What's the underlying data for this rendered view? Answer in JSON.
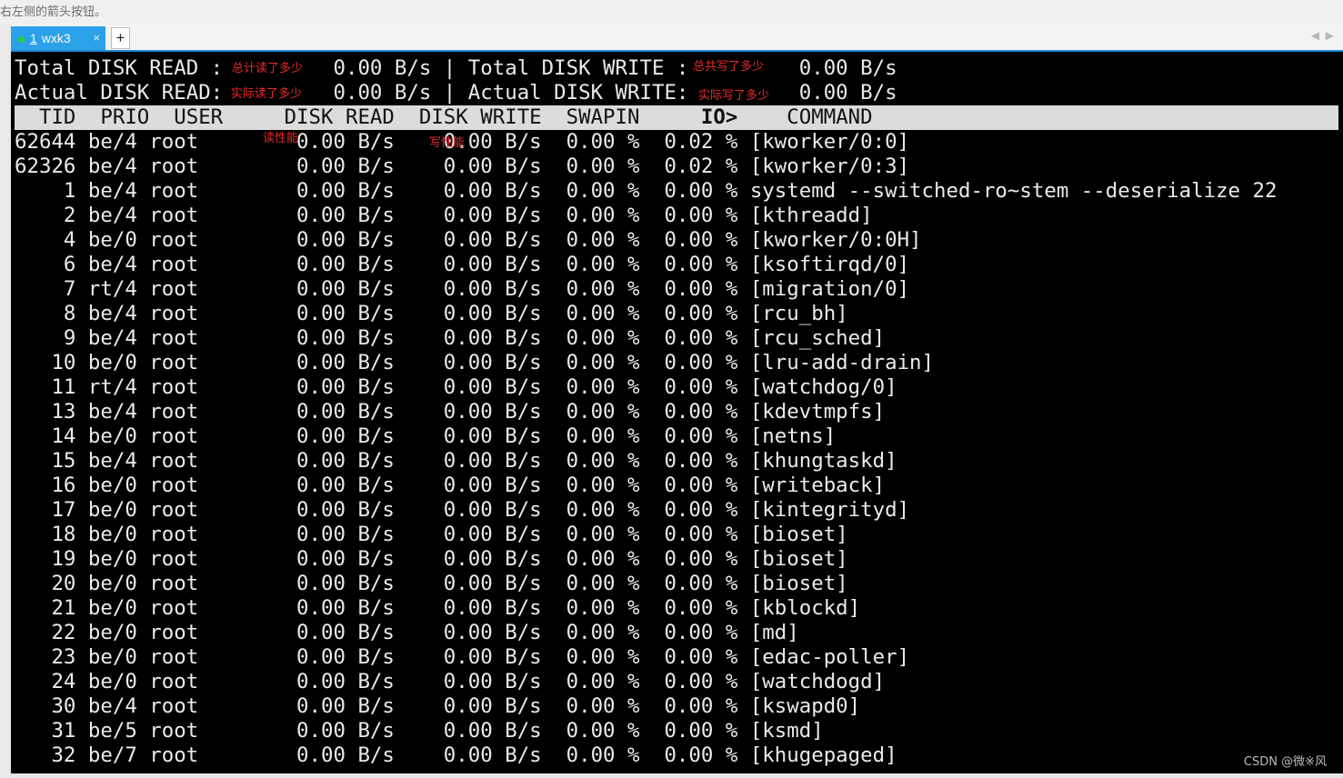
{
  "top_hint": "右左侧的箭头按钮。",
  "tabbar": {
    "tab_number": "1",
    "tab_label": "wxk3",
    "tab_close": "×",
    "add_tab": "+",
    "nav_left": "◀",
    "nav_right": "▶"
  },
  "summary": {
    "line1": "Total DISK READ :         0.00 B/s | Total DISK WRITE :         0.00 B/s",
    "line2": "Actual DISK READ:         0.00 B/s | Actual DISK WRITE:         0.00 B/s"
  },
  "annotations": {
    "total_read": "总计读了多少",
    "total_write": "总共写了多少",
    "actual_read": "实际读了多少",
    "actual_write": "实际写了多少",
    "read_perf": "读性能",
    "write_perf": "写性能"
  },
  "header": {
    "pre": "  TID  PRIO  USER     DISK READ  DISK WRITE  SWAPIN     ",
    "io": "IO>",
    "post": "    COMMAND"
  },
  "rows": [
    "62644 be/4 root        0.00 B/s    0.00 B/s  0.00 %  0.02 % [kworker/0:0]",
    "62326 be/4 root        0.00 B/s    0.00 B/s  0.00 %  0.02 % [kworker/0:3]",
    "    1 be/4 root        0.00 B/s    0.00 B/s  0.00 %  0.00 % systemd --switched-ro~stem --deserialize 22",
    "    2 be/4 root        0.00 B/s    0.00 B/s  0.00 %  0.00 % [kthreadd]",
    "    4 be/0 root        0.00 B/s    0.00 B/s  0.00 %  0.00 % [kworker/0:0H]",
    "    6 be/4 root        0.00 B/s    0.00 B/s  0.00 %  0.00 % [ksoftirqd/0]",
    "    7 rt/4 root        0.00 B/s    0.00 B/s  0.00 %  0.00 % [migration/0]",
    "    8 be/4 root        0.00 B/s    0.00 B/s  0.00 %  0.00 % [rcu_bh]",
    "    9 be/4 root        0.00 B/s    0.00 B/s  0.00 %  0.00 % [rcu_sched]",
    "   10 be/0 root        0.00 B/s    0.00 B/s  0.00 %  0.00 % [lru-add-drain]",
    "   11 rt/4 root        0.00 B/s    0.00 B/s  0.00 %  0.00 % [watchdog/0]",
    "   13 be/4 root        0.00 B/s    0.00 B/s  0.00 %  0.00 % [kdevtmpfs]",
    "   14 be/0 root        0.00 B/s    0.00 B/s  0.00 %  0.00 % [netns]",
    "   15 be/4 root        0.00 B/s    0.00 B/s  0.00 %  0.00 % [khungtaskd]",
    "   16 be/0 root        0.00 B/s    0.00 B/s  0.00 %  0.00 % [writeback]",
    "   17 be/0 root        0.00 B/s    0.00 B/s  0.00 %  0.00 % [kintegrityd]",
    "   18 be/0 root        0.00 B/s    0.00 B/s  0.00 %  0.00 % [bioset]",
    "   19 be/0 root        0.00 B/s    0.00 B/s  0.00 %  0.00 % [bioset]",
    "   20 be/0 root        0.00 B/s    0.00 B/s  0.00 %  0.00 % [bioset]",
    "   21 be/0 root        0.00 B/s    0.00 B/s  0.00 %  0.00 % [kblockd]",
    "   22 be/0 root        0.00 B/s    0.00 B/s  0.00 %  0.00 % [md]",
    "   23 be/0 root        0.00 B/s    0.00 B/s  0.00 %  0.00 % [edac-poller]",
    "   24 be/0 root        0.00 B/s    0.00 B/s  0.00 %  0.00 % [watchdogd]",
    "   30 be/4 root        0.00 B/s    0.00 B/s  0.00 %  0.00 % [kswapd0]",
    "   31 be/5 root        0.00 B/s    0.00 B/s  0.00 %  0.00 % [ksmd]",
    "   32 be/7 root        0.00 B/s    0.00 B/s  0.00 %  0.00 % [khugepaged]"
  ],
  "watermark": "CSDN @微※风"
}
